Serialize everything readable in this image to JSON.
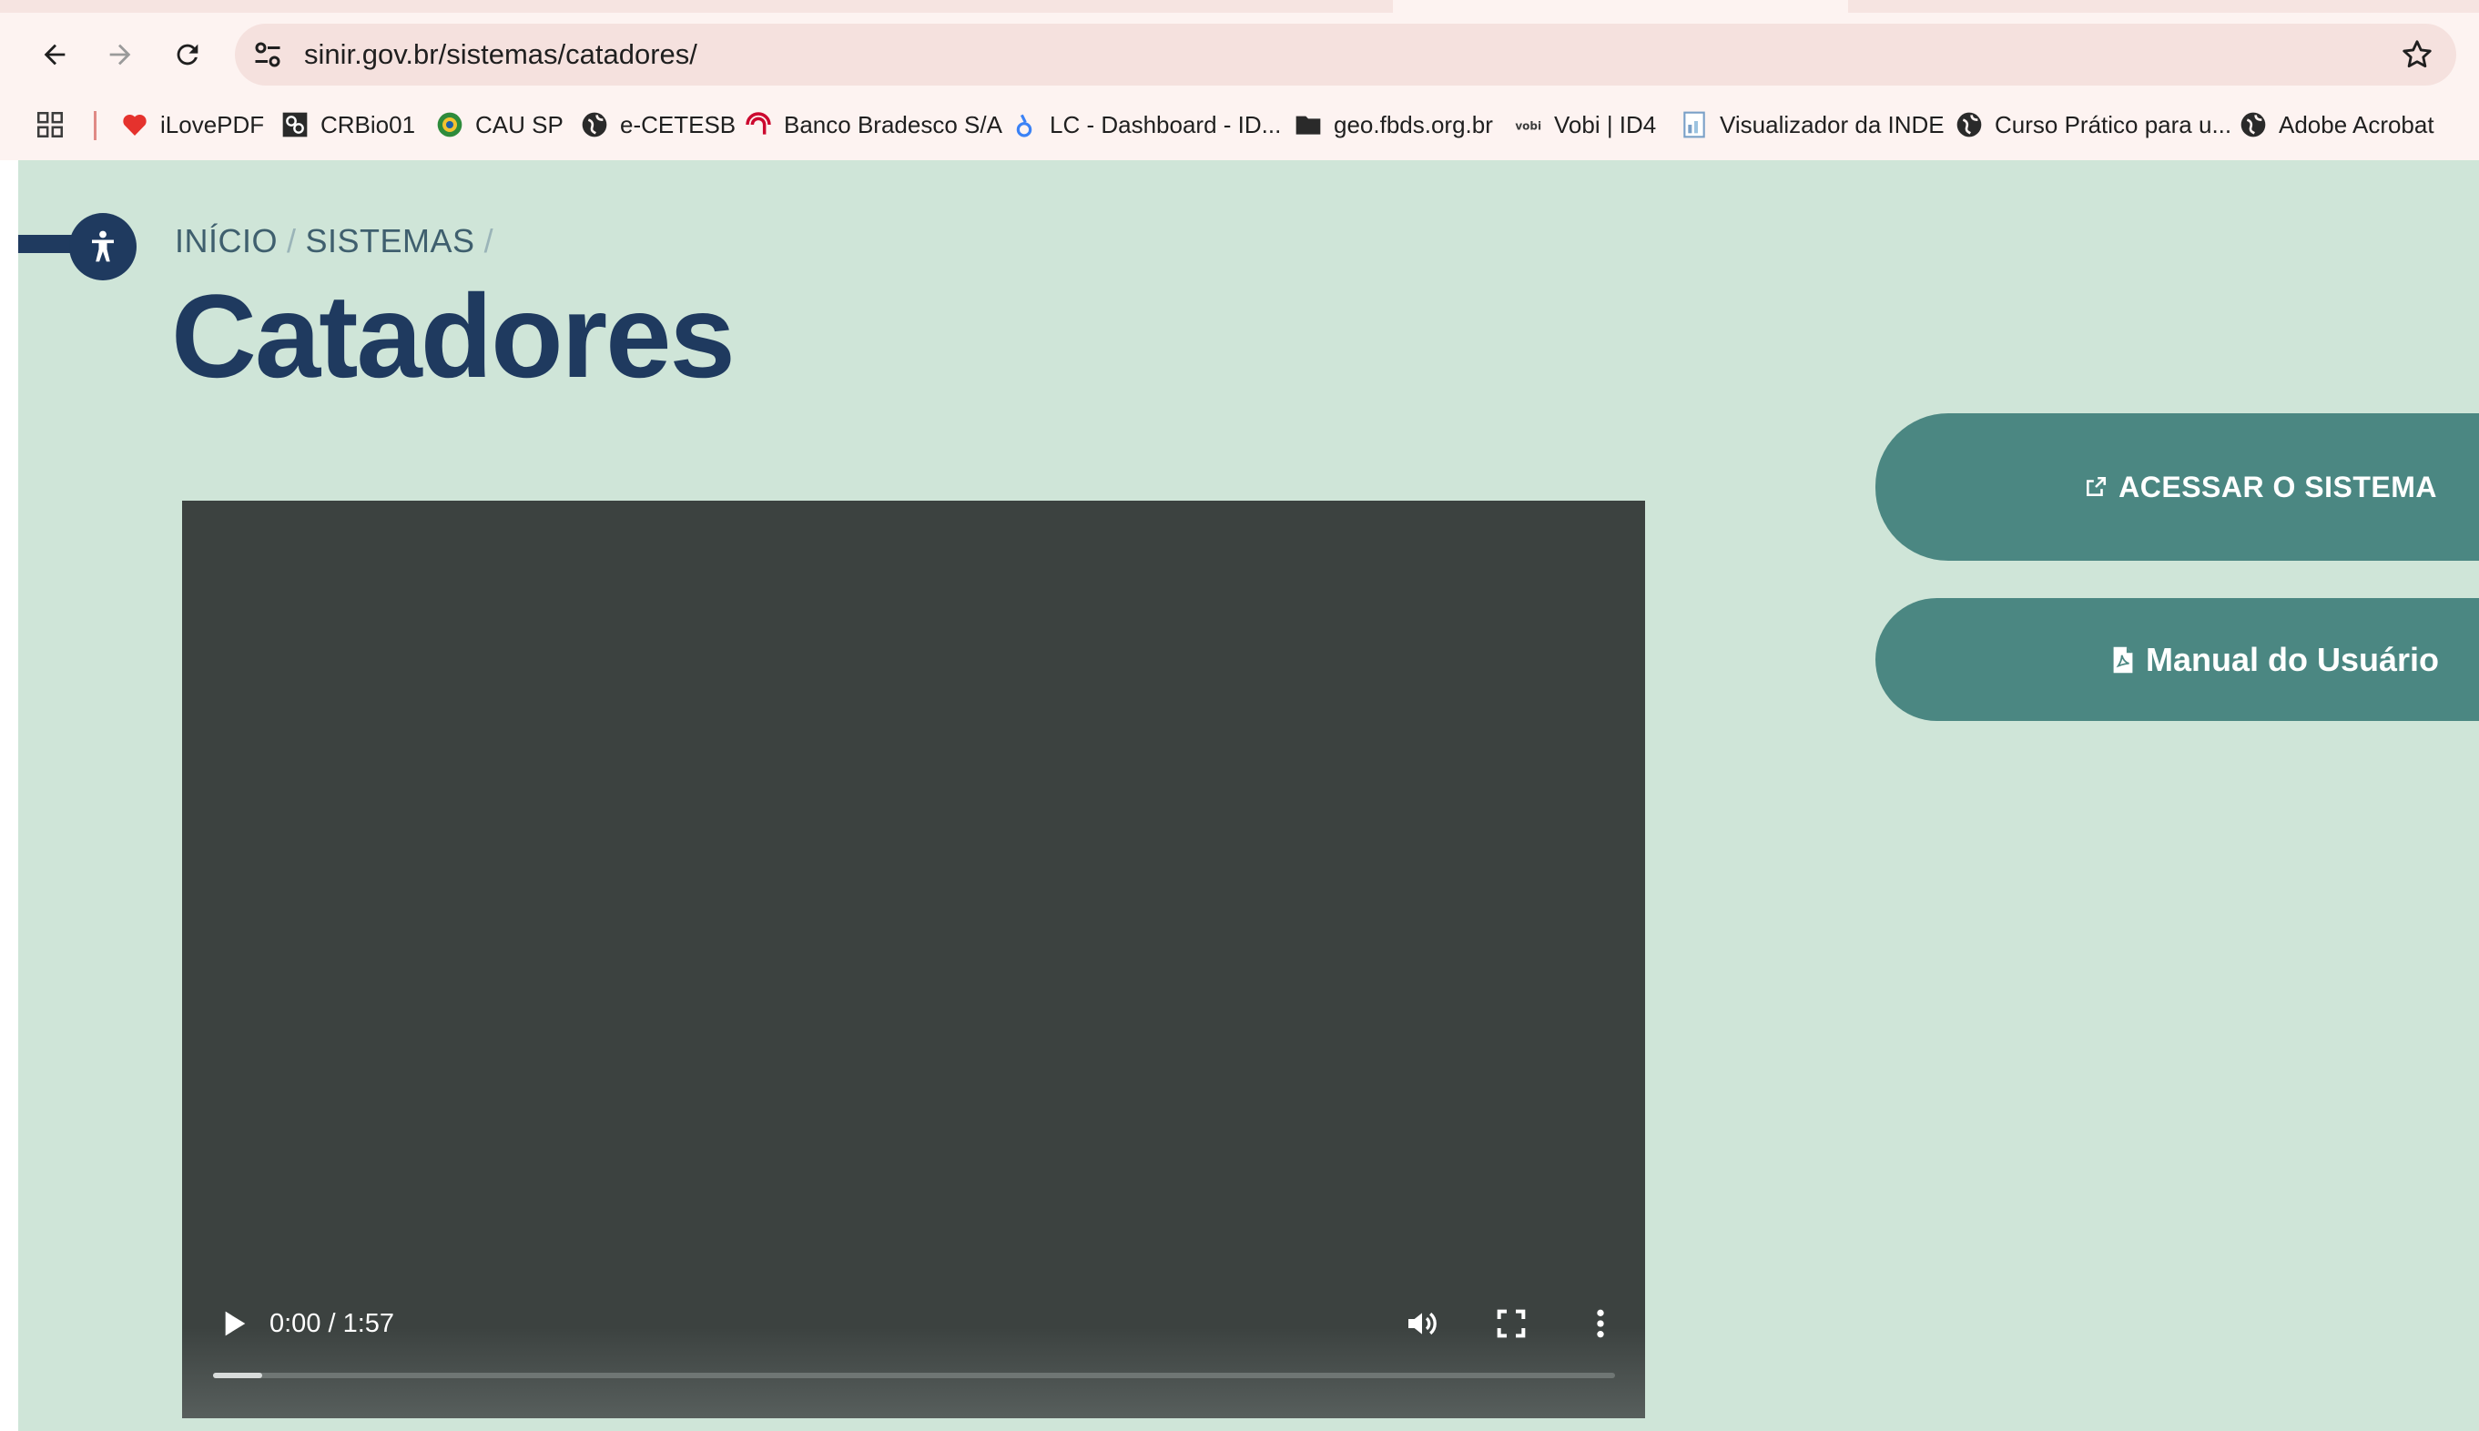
{
  "browser": {
    "url": "sinir.gov.br/sistemas/catadores/",
    "bookmarks": [
      {
        "label": "iLovePDF",
        "icon": "heart-icon"
      },
      {
        "label": "CRBio01",
        "icon": "crbio-icon"
      },
      {
        "label": "CAU SP",
        "icon": "globe-seal-icon"
      },
      {
        "label": "e-CETESB",
        "icon": "globe-icon"
      },
      {
        "label": "Banco Bradesco S/A",
        "icon": "bradesco-icon"
      },
      {
        "label": "LC - Dashboard - ID...",
        "icon": "drop-icon"
      },
      {
        "label": "geo.fbds.org.br",
        "icon": "folder-icon"
      },
      {
        "label": "Vobi | ID4",
        "icon": "vobi-icon"
      },
      {
        "label": "Visualizador da INDE",
        "icon": "document-icon"
      },
      {
        "label": "Curso Prático para u...",
        "icon": "globe-icon"
      },
      {
        "label": "Adobe Acrobat",
        "icon": "globe-icon"
      }
    ]
  },
  "page": {
    "breadcrumb": {
      "home": "INÍCIO",
      "separator": "/",
      "current": "SISTEMAS"
    },
    "title": "Catadores",
    "video": {
      "time": "0:00 / 1:57",
      "progress_fraction": 0.035
    },
    "buttons": {
      "access": "ACESSAR O SISTEMA",
      "manual": "Manual do Usuário"
    }
  },
  "colors": {
    "page_background": "#cfe5d8",
    "title": "#1f3a5f",
    "button": "#4b8782",
    "video_background": "#3c4240"
  }
}
